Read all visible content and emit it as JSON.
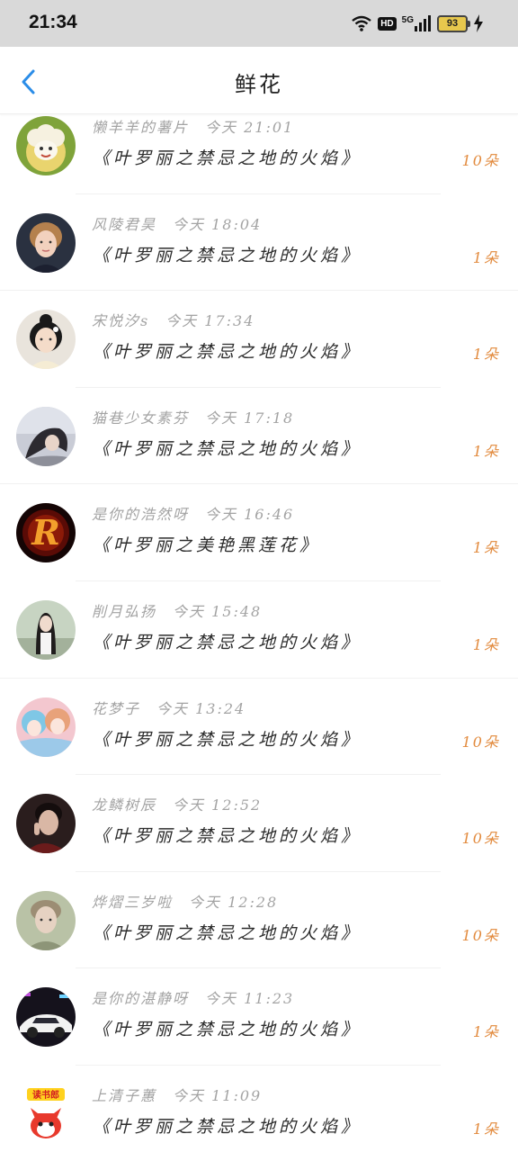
{
  "status_bar": {
    "time": "21:34",
    "hd": "HD",
    "network": "5G",
    "battery": "93"
  },
  "header": {
    "title": "鲜花"
  },
  "colors": {
    "accent": "#2b8de8",
    "count": "#e28a3d",
    "muted": "#a3a3a3"
  },
  "items": [
    {
      "name": "懒羊羊的薯片",
      "time": "今天 21:01",
      "message": "《叶罗丽之禁忌之地的火焰》",
      "count": "10朵",
      "avatar": "cartoon-sheep-avatar"
    },
    {
      "name": "风陵君昊",
      "time": "今天 18:04",
      "message": "《叶罗丽之禁忌之地的火焰》",
      "count": "1朵",
      "avatar": "user-photo-avatar"
    },
    {
      "name": "宋悦汐s",
      "time": "今天 17:34",
      "message": "《叶罗丽之禁忌之地的火焰》",
      "count": "1朵",
      "avatar": "user-photo-avatar"
    },
    {
      "name": "猫巷少女素芬",
      "time": "今天 17:18",
      "message": "《叶罗丽之禁忌之地的火焰》",
      "count": "1朵",
      "avatar": "user-photo-avatar"
    },
    {
      "name": "是你的浩然呀",
      "time": "今天 16:46",
      "message": "《叶罗丽之美艳黑莲花》",
      "count": "1朵",
      "avatar": "fire-letter-avatar"
    },
    {
      "name": "削月弘扬",
      "time": "今天 15:48",
      "message": "《叶罗丽之禁忌之地的火焰》",
      "count": "1朵",
      "avatar": "user-photo-avatar"
    },
    {
      "name": "花梦子",
      "time": "今天 13:24",
      "message": "《叶罗丽之禁忌之地的火焰》",
      "count": "10朵",
      "avatar": "anime-avatar"
    },
    {
      "name": "龙鳞树辰",
      "time": "今天 12:52",
      "message": "《叶罗丽之禁忌之地的火焰》",
      "count": "10朵",
      "avatar": "user-photo-avatar"
    },
    {
      "name": "烨熠三岁啦",
      "time": "今天 12:28",
      "message": "《叶罗丽之禁忌之地的火焰》",
      "count": "10朵",
      "avatar": "user-photo-avatar"
    },
    {
      "name": "是你的湛静呀",
      "time": "今天 11:23",
      "message": "《叶罗丽之禁忌之地的火焰》",
      "count": "1朵",
      "avatar": "car-photo-avatar"
    },
    {
      "name": "上清子蕙",
      "time": "今天 11:09",
      "message": "《叶罗丽之禁忌之地的火焰》",
      "count": "1朵",
      "avatar": "cartoon-fox-avatar",
      "avatar_badge": "读书郎"
    }
  ]
}
